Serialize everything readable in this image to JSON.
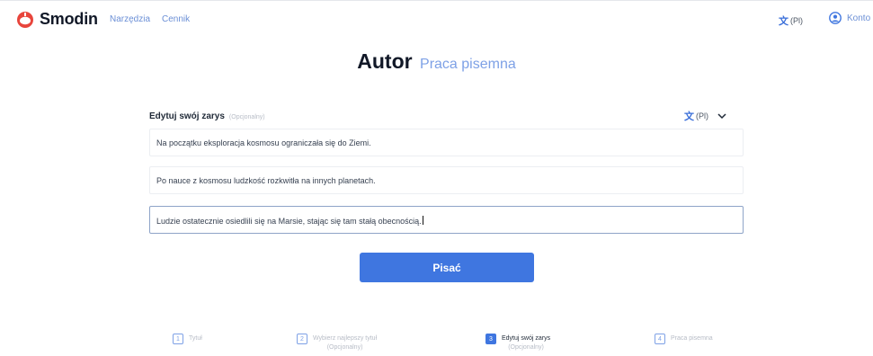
{
  "nav": {
    "brand": "Smodin",
    "links": [
      "Narzędzia",
      "Cennik"
    ],
    "language": "(Pl)",
    "account": "Konto"
  },
  "page": {
    "title": "Autor",
    "subtitle": "Praca pisemna"
  },
  "outline": {
    "heading": "Edytuj swój zarys",
    "optional": "(Opcjonalny)",
    "language": "(Pl)",
    "lines": [
      "Na początku eksploracja kosmosu ograniczała się do Ziemi.",
      "Po nauce z kosmosu ludzkość rozkwitła na innych planetach.",
      "Ludzie ostatecznie osiedlili się na Marsie, stając się tam stałą obecnością."
    ]
  },
  "actions": {
    "write": "Pisać"
  },
  "steps": [
    {
      "num": "1",
      "label": "Tytuł",
      "optional": ""
    },
    {
      "num": "2",
      "label": "Wybierz najlepszy tytuł",
      "optional": "(Opcjonalny)"
    },
    {
      "num": "3",
      "label": "Edytuj swój zarys",
      "optional": "(Opcjonalny)"
    },
    {
      "num": "4",
      "label": "Praca pisemna",
      "optional": ""
    }
  ],
  "colors": {
    "accent": "#3f76e0",
    "link": "#6b8fd6",
    "brand_logo": "#e8453c"
  },
  "icons": [
    "smodin-logo-icon",
    "translate-icon",
    "account-icon",
    "chevron-down-icon"
  ]
}
